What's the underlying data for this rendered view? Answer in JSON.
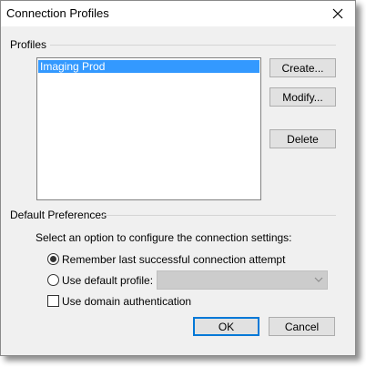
{
  "window": {
    "title": "Connection Profiles"
  },
  "profiles": {
    "group_label": "Profiles",
    "items": [
      "Imaging Prod"
    ],
    "buttons": {
      "create": "Create...",
      "modify": "Modify...",
      "delete": "Delete"
    }
  },
  "preferences": {
    "group_label": "Default Preferences",
    "instruction": "Select an option to configure the connection settings:",
    "radio_remember": {
      "label": "Remember last successful connection attempt",
      "checked": true
    },
    "radio_default": {
      "label": "Use default profile:",
      "checked": false
    },
    "default_profile_value": "",
    "checkbox_domain": {
      "label": "Use domain authentication",
      "checked": false
    }
  },
  "footer": {
    "ok": "OK",
    "cancel": "Cancel"
  },
  "colors": {
    "selection": "#3399ff",
    "dialog_bg": "#f0f0f0",
    "default_button_border": "#0078d7"
  },
  "icons": {
    "close": "close-icon",
    "dropdown": "chevron-down-icon"
  }
}
